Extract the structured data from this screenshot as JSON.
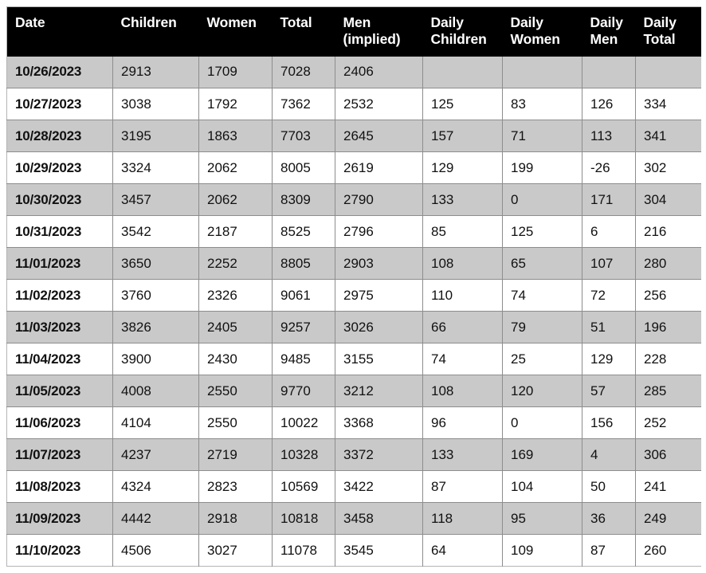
{
  "table": {
    "columns": [
      {
        "key": "date",
        "label": "Date",
        "class": "c-date"
      },
      {
        "key": "children",
        "label": "Children",
        "class": "c-children"
      },
      {
        "key": "women",
        "label": "Women",
        "class": "c-women"
      },
      {
        "key": "total",
        "label": "Total",
        "class": "c-total"
      },
      {
        "key": "men_implied",
        "label": "Men\n(implied)",
        "class": "c-men"
      },
      {
        "key": "daily_children",
        "label": "Daily\nChildren",
        "class": "c-dchild"
      },
      {
        "key": "daily_women",
        "label": "Daily\nWomen",
        "class": "c-dwomen"
      },
      {
        "key": "daily_men",
        "label": "Daily\nMen",
        "class": "c-dmen"
      },
      {
        "key": "daily_total",
        "label": "Daily\nTotal",
        "class": "c-dtotal"
      }
    ],
    "rows": [
      {
        "date": "10/26/2023",
        "children": "2913",
        "women": "1709",
        "total": "7028",
        "men_implied": "2406",
        "daily_children": "",
        "daily_women": "",
        "daily_men": "",
        "daily_total": ""
      },
      {
        "date": "10/27/2023",
        "children": "3038",
        "women": "1792",
        "total": "7362",
        "men_implied": "2532",
        "daily_children": "125",
        "daily_women": "83",
        "daily_men": "126",
        "daily_total": "334"
      },
      {
        "date": "10/28/2023",
        "children": "3195",
        "women": "1863",
        "total": "7703",
        "men_implied": "2645",
        "daily_children": "157",
        "daily_women": "71",
        "daily_men": "113",
        "daily_total": "341"
      },
      {
        "date": "10/29/2023",
        "children": "3324",
        "women": "2062",
        "total": "8005",
        "men_implied": "2619",
        "daily_children": "129",
        "daily_women": "199",
        "daily_men": "-26",
        "daily_total": "302"
      },
      {
        "date": "10/30/2023",
        "children": "3457",
        "women": "2062",
        "total": "8309",
        "men_implied": "2790",
        "daily_children": "133",
        "daily_women": "0",
        "daily_men": "171",
        "daily_total": "304"
      },
      {
        "date": "10/31/2023",
        "children": "3542",
        "women": "2187",
        "total": "8525",
        "men_implied": "2796",
        "daily_children": "85",
        "daily_women": "125",
        "daily_men": "6",
        "daily_total": "216"
      },
      {
        "date": "11/01/2023",
        "children": "3650",
        "women": "2252",
        "total": "8805",
        "men_implied": "2903",
        "daily_children": "108",
        "daily_women": "65",
        "daily_men": "107",
        "daily_total": "280"
      },
      {
        "date": "11/02/2023",
        "children": "3760",
        "women": "2326",
        "total": "9061",
        "men_implied": "2975",
        "daily_children": "110",
        "daily_women": "74",
        "daily_men": "72",
        "daily_total": "256"
      },
      {
        "date": "11/03/2023",
        "children": "3826",
        "women": "2405",
        "total": "9257",
        "men_implied": "3026",
        "daily_children": "66",
        "daily_women": "79",
        "daily_men": "51",
        "daily_total": "196"
      },
      {
        "date": "11/04/2023",
        "children": "3900",
        "women": "2430",
        "total": "9485",
        "men_implied": "3155",
        "daily_children": "74",
        "daily_women": "25",
        "daily_men": "129",
        "daily_total": "228"
      },
      {
        "date": "11/05/2023",
        "children": "4008",
        "women": "2550",
        "total": "9770",
        "men_implied": "3212",
        "daily_children": "108",
        "daily_women": "120",
        "daily_men": "57",
        "daily_total": "285"
      },
      {
        "date": "11/06/2023",
        "children": "4104",
        "women": "2550",
        "total": "10022",
        "men_implied": "3368",
        "daily_children": "96",
        "daily_women": "0",
        "daily_men": "156",
        "daily_total": "252"
      },
      {
        "date": "11/07/2023",
        "children": "4237",
        "women": "2719",
        "total": "10328",
        "men_implied": "3372",
        "daily_children": "133",
        "daily_women": "169",
        "daily_men": "4",
        "daily_total": "306"
      },
      {
        "date": "11/08/2023",
        "children": "4324",
        "women": "2823",
        "total": "10569",
        "men_implied": "3422",
        "daily_children": "87",
        "daily_women": "104",
        "daily_men": "50",
        "daily_total": "241"
      },
      {
        "date": "11/09/2023",
        "children": "4442",
        "women": "2918",
        "total": "10818",
        "men_implied": "3458",
        "daily_children": "118",
        "daily_women": "95",
        "daily_men": "36",
        "daily_total": "249"
      },
      {
        "date": "11/10/2023",
        "children": "4506",
        "women": "3027",
        "total": "11078",
        "men_implied": "3545",
        "daily_children": "64",
        "daily_women": "109",
        "daily_men": "87",
        "daily_total": "260"
      }
    ],
    "colors": {
      "header_background": "#000000",
      "header_text": "#ffffff",
      "row_shaded_background": "#c9c9c9",
      "row_plain_background": "#ffffff",
      "grid_line": "#8d8d8d",
      "cell_text": "#111111"
    }
  }
}
